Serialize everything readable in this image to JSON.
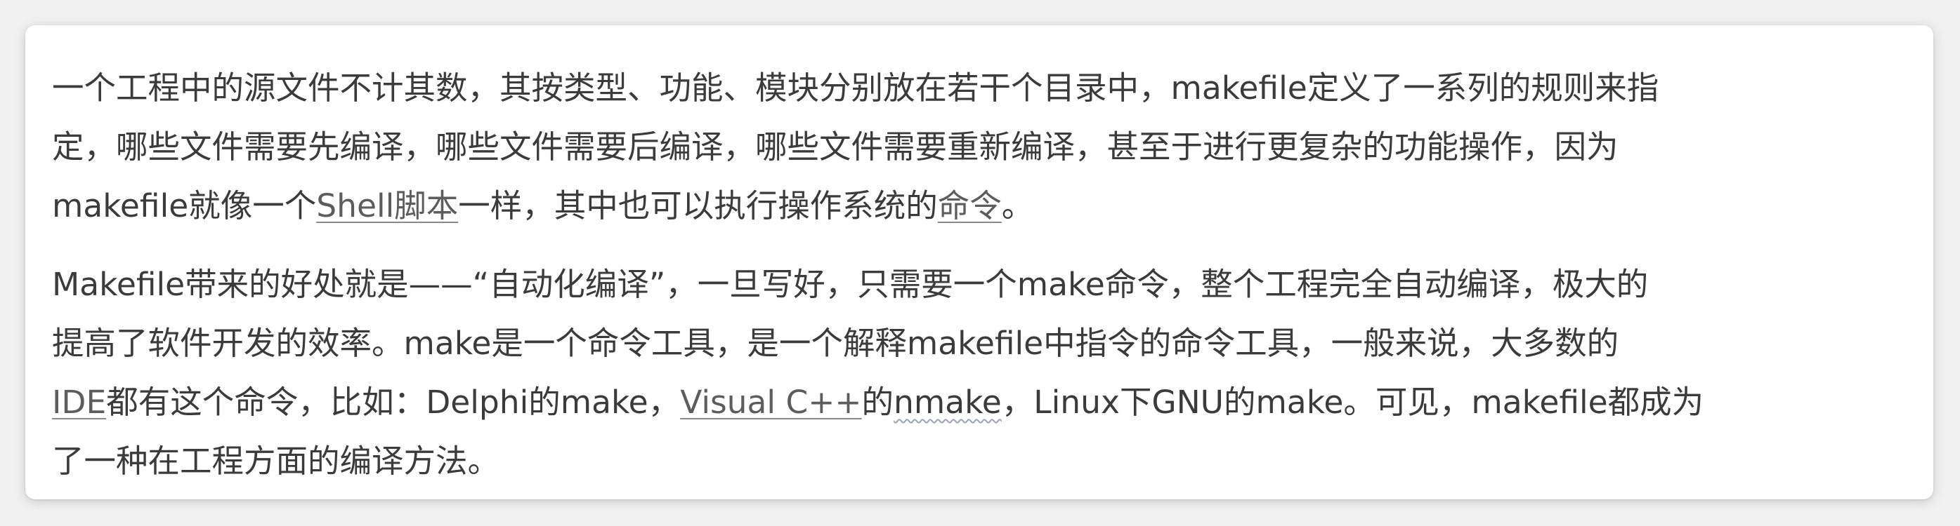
{
  "paragraph1": {
    "line1": "一个工程中的源文件不计其数，其按类型、功能、模块分别放在若干个目录中，makefile定义了一系列的规则来指",
    "line2": "定，哪些文件需要先编译，哪些文件需要后编译，哪些文件需要重新编译，甚至于进行更复杂的功能操作，因为",
    "line3_pre": "makefile就像一个",
    "link_shell": "Shell脚本",
    "line3_mid": "一样，其中也可以执行操作系统的",
    "link_command": "命令",
    "line3_post": "。"
  },
  "paragraph2": {
    "line1": "Makefile带来的好处就是——“自动化编译”，一旦写好，只需要一个make命令，整个工程完全自动编译，极大的",
    "line2": "提高了软件开发的效率。make是一个命令工具，是一个解释makefile中指令的命令工具，一般来说，大多数的",
    "link_ide": "IDE",
    "line3_a": "都有这个命令，比如：Delphi的make，",
    "link_vcpp": "Visual C++",
    "line3_b": "的",
    "nmake": "nmake",
    "line3_c": "，Linux下GNU的make。可见，makefile都成为",
    "line4": "了一种在工程方面的编译方法。"
  }
}
